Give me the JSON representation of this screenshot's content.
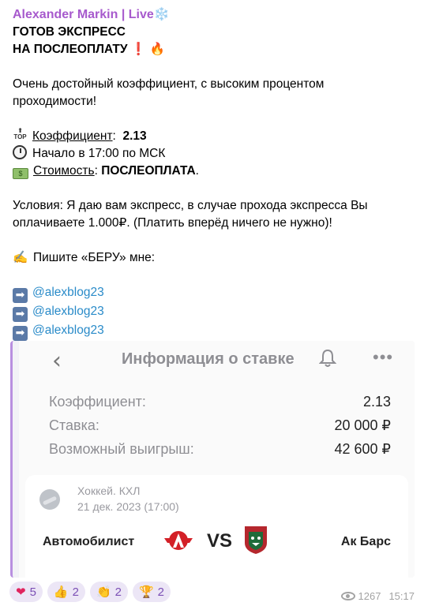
{
  "message": {
    "author": "Alexander Markin | Live",
    "author_emoji": "❄️",
    "title_line1": "ГОТОВ ЭКСПРЕСС",
    "title_line2": "НА ПОСЛЕОПЛАТУ",
    "title_emojis": "❗ 🔥",
    "desc_line1": "Очень достойный коэффициент, с высоким процентом",
    "desc_line2": "проходимости!",
    "coef_icon": "TOP",
    "coef_label": "Коэффициент",
    "coef_sep": ":",
    "coef_value": "2.13",
    "start_text": "Начало в 17:00 по МСК",
    "cost_icon": "$",
    "cost_label": "Стоимость",
    "cost_sep": ":",
    "cost_value": "ПОСЛЕОПЛАТА",
    "cost_end": ".",
    "cond_line1": "Условия: Я даю вам экспресс, в случае прохода экспресса Вы",
    "cond_line2": "оплачиваете 1.000₽. (Платить вперёд ничего не нужно)!",
    "write_emoji": "✍️",
    "write_text": "Пишите «БЕРУ» мне:",
    "arrow": "➡",
    "links": [
      "@alexblog23",
      "@alexblog23",
      "@alexblog23"
    ]
  },
  "screenshot": {
    "back_glyph": "‹",
    "title": "Информация о ставке",
    "more_glyph": "•••",
    "rows": [
      {
        "label": "Коэффициент:",
        "value": "2.13"
      },
      {
        "label": "Ставка:",
        "value": "20 000 ₽"
      },
      {
        "label": "Возможный выигрыш:",
        "value": "42 600 ₽"
      }
    ],
    "league": "Хоккей. КХЛ",
    "date": "21 дек. 2023 (17:00)",
    "team_home": "Автомобилист",
    "vs": "VS",
    "team_away": "Ак Барс"
  },
  "reactions": [
    {
      "icon": "❤",
      "count": "5"
    },
    {
      "icon": "👍",
      "count": "2"
    },
    {
      "icon": "👏",
      "count": "2"
    },
    {
      "icon": "🏆",
      "count": "2"
    }
  ],
  "meta": {
    "views": "1267",
    "time": "15:17"
  },
  "colors": {
    "author": "#a75acd",
    "link": "#2a8bc9",
    "accent_bar": "#b88fe0",
    "reaction_bg": "#ece6f6"
  }
}
